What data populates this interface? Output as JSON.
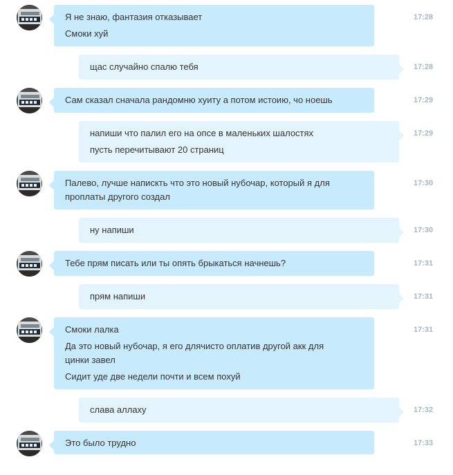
{
  "messages": [
    {
      "direction": "in",
      "lines": [
        "Я не знаю, фантазия отказывает",
        "Смоки хуй"
      ],
      "time": "17:28"
    },
    {
      "direction": "out",
      "lines": [
        "щас случайно спалю тебя"
      ],
      "time": "17:28"
    },
    {
      "direction": "in",
      "lines": [
        "Сам сказал сначала рандомню хуиту а потом истоию, чо ноешь"
      ],
      "time": "17:29"
    },
    {
      "direction": "out",
      "lines": [
        "напиши что палил его на опсе в маленьких шалостях",
        "пусть перечитывают 20 страниц"
      ],
      "time": "17:29"
    },
    {
      "direction": "in",
      "lines": [
        "Палево, лучше напискть что это новый нубочар, который я для",
        "проплаты другого создал"
      ],
      "time": "17:30"
    },
    {
      "direction": "out",
      "lines": [
        "ну напиши"
      ],
      "time": "17:30"
    },
    {
      "direction": "in",
      "lines": [
        "Тебе прям писать или ты опять брыкаться начнешь?"
      ],
      "time": "17:31"
    },
    {
      "direction": "out",
      "lines": [
        "прям напиши"
      ],
      "time": "17:31"
    },
    {
      "direction": "in",
      "lines": [
        "Смоки лалка",
        "Да это новый нубочар, я его длячисто оплатив другой акк для",
        "цинки завел",
        "Сидит уде две недели почти и всем похуй"
      ],
      "time": "17:31"
    },
    {
      "direction": "out",
      "lines": [
        "слава аллаху"
      ],
      "time": "17:32"
    },
    {
      "direction": "in",
      "lines": [
        "Это было трудно"
      ],
      "time": "17:33"
    }
  ],
  "colors": {
    "incoming_bubble": "#c7ebfc",
    "outgoing_bubble": "#e3f4fc",
    "timestamp": "#a3b7c4",
    "text": "#333333"
  },
  "icons": {
    "avatar": "avatar-picture"
  }
}
